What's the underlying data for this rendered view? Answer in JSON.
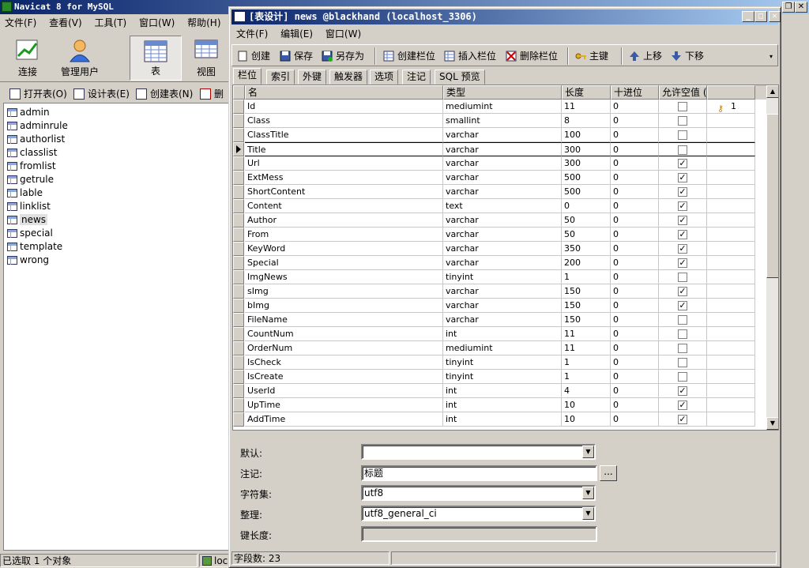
{
  "app": {
    "title": "Navicat 8 for MySQL",
    "menu": [
      "文件(F)",
      "查看(V)",
      "工具(T)",
      "窗口(W)",
      "帮助(H)"
    ],
    "toolbar": [
      "连接",
      "管理用户",
      "表",
      "视图"
    ],
    "object_toolbar": [
      "打开表(O)",
      "设计表(E)",
      "创建表(N)",
      "删"
    ],
    "tables": [
      "admin",
      "adminrule",
      "authorlist",
      "classlist",
      "fromlist",
      "getrule",
      "lable",
      "linklist",
      "news",
      "special",
      "template",
      "wrong"
    ],
    "selected_table": "news",
    "status_left": "已选取 1 个对象",
    "status_conn": "loc"
  },
  "design": {
    "title": "[表设计] news @blackhand (localhost_3306)",
    "menu": [
      "文件(F)",
      "编辑(E)",
      "窗口(W)"
    ],
    "toolbar": [
      "创建",
      "保存",
      "另存为",
      "创建栏位",
      "插入栏位",
      "删除栏位",
      "主键",
      "上移",
      "下移"
    ],
    "tabs": [
      "栏位",
      "索引",
      "外键",
      "触发器",
      "选项",
      "注记",
      "SQL 预览"
    ],
    "active_tab": "栏位",
    "columns": [
      "名",
      "类型",
      "长度",
      "十进位",
      "允许空值 (",
      ""
    ],
    "rows": [
      {
        "name": "Id",
        "type": "mediumint",
        "length": "11",
        "decimals": "0",
        "nullable": false,
        "key": "1"
      },
      {
        "name": "Class",
        "type": "smallint",
        "length": "8",
        "decimals": "0",
        "nullable": false,
        "key": ""
      },
      {
        "name": "ClassTitle",
        "type": "varchar",
        "length": "100",
        "decimals": "0",
        "nullable": false,
        "key": ""
      },
      {
        "name": "Title",
        "type": "varchar",
        "length": "300",
        "decimals": "0",
        "nullable": false,
        "key": ""
      },
      {
        "name": "Url",
        "type": "varchar",
        "length": "300",
        "decimals": "0",
        "nullable": true,
        "key": ""
      },
      {
        "name": "ExtMess",
        "type": "varchar",
        "length": "500",
        "decimals": "0",
        "nullable": true,
        "key": ""
      },
      {
        "name": "ShortContent",
        "type": "varchar",
        "length": "500",
        "decimals": "0",
        "nullable": true,
        "key": ""
      },
      {
        "name": "Content",
        "type": "text",
        "length": "0",
        "decimals": "0",
        "nullable": true,
        "key": ""
      },
      {
        "name": "Author",
        "type": "varchar",
        "length": "50",
        "decimals": "0",
        "nullable": true,
        "key": ""
      },
      {
        "name": "From",
        "type": "varchar",
        "length": "50",
        "decimals": "0",
        "nullable": true,
        "key": ""
      },
      {
        "name": "KeyWord",
        "type": "varchar",
        "length": "350",
        "decimals": "0",
        "nullable": true,
        "key": ""
      },
      {
        "name": "Special",
        "type": "varchar",
        "length": "200",
        "decimals": "0",
        "nullable": true,
        "key": ""
      },
      {
        "name": "ImgNews",
        "type": "tinyint",
        "length": "1",
        "decimals": "0",
        "nullable": false,
        "key": ""
      },
      {
        "name": "sImg",
        "type": "varchar",
        "length": "150",
        "decimals": "0",
        "nullable": true,
        "key": ""
      },
      {
        "name": "bImg",
        "type": "varchar",
        "length": "150",
        "decimals": "0",
        "nullable": true,
        "key": ""
      },
      {
        "name": "FileName",
        "type": "varchar",
        "length": "150",
        "decimals": "0",
        "nullable": false,
        "key": ""
      },
      {
        "name": "CountNum",
        "type": "int",
        "length": "11",
        "decimals": "0",
        "nullable": false,
        "key": ""
      },
      {
        "name": "OrderNum",
        "type": "mediumint",
        "length": "11",
        "decimals": "0",
        "nullable": false,
        "key": ""
      },
      {
        "name": "IsCheck",
        "type": "tinyint",
        "length": "1",
        "decimals": "0",
        "nullable": false,
        "key": ""
      },
      {
        "name": "IsCreate",
        "type": "tinyint",
        "length": "1",
        "decimals": "0",
        "nullable": false,
        "key": ""
      },
      {
        "name": "UserId",
        "type": "int",
        "length": "4",
        "decimals": "0",
        "nullable": true,
        "key": ""
      },
      {
        "name": "UpTime",
        "type": "int",
        "length": "10",
        "decimals": "0",
        "nullable": true,
        "key": ""
      },
      {
        "name": "AddTime",
        "type": "int",
        "length": "10",
        "decimals": "0",
        "nullable": true,
        "key": ""
      }
    ],
    "current_row": "Title",
    "props": {
      "default_label": "默认:",
      "default_value": "",
      "comment_label": "注记:",
      "comment_value": "标题",
      "charset_label": "字符集:",
      "charset_value": "utf8",
      "collation_label": "整理:",
      "collation_value": "utf8_general_ci",
      "keylen_label": "键长度:",
      "keylen_value": ""
    },
    "status": "字段数: 23"
  },
  "colors": {
    "titlebar": "#0a246a",
    "face": "#d4d0c8"
  },
  "icons": [
    "connect-icon",
    "user-icon",
    "table-icon",
    "view-icon",
    "key-icon",
    "arrow-up-icon",
    "arrow-down-icon"
  ]
}
